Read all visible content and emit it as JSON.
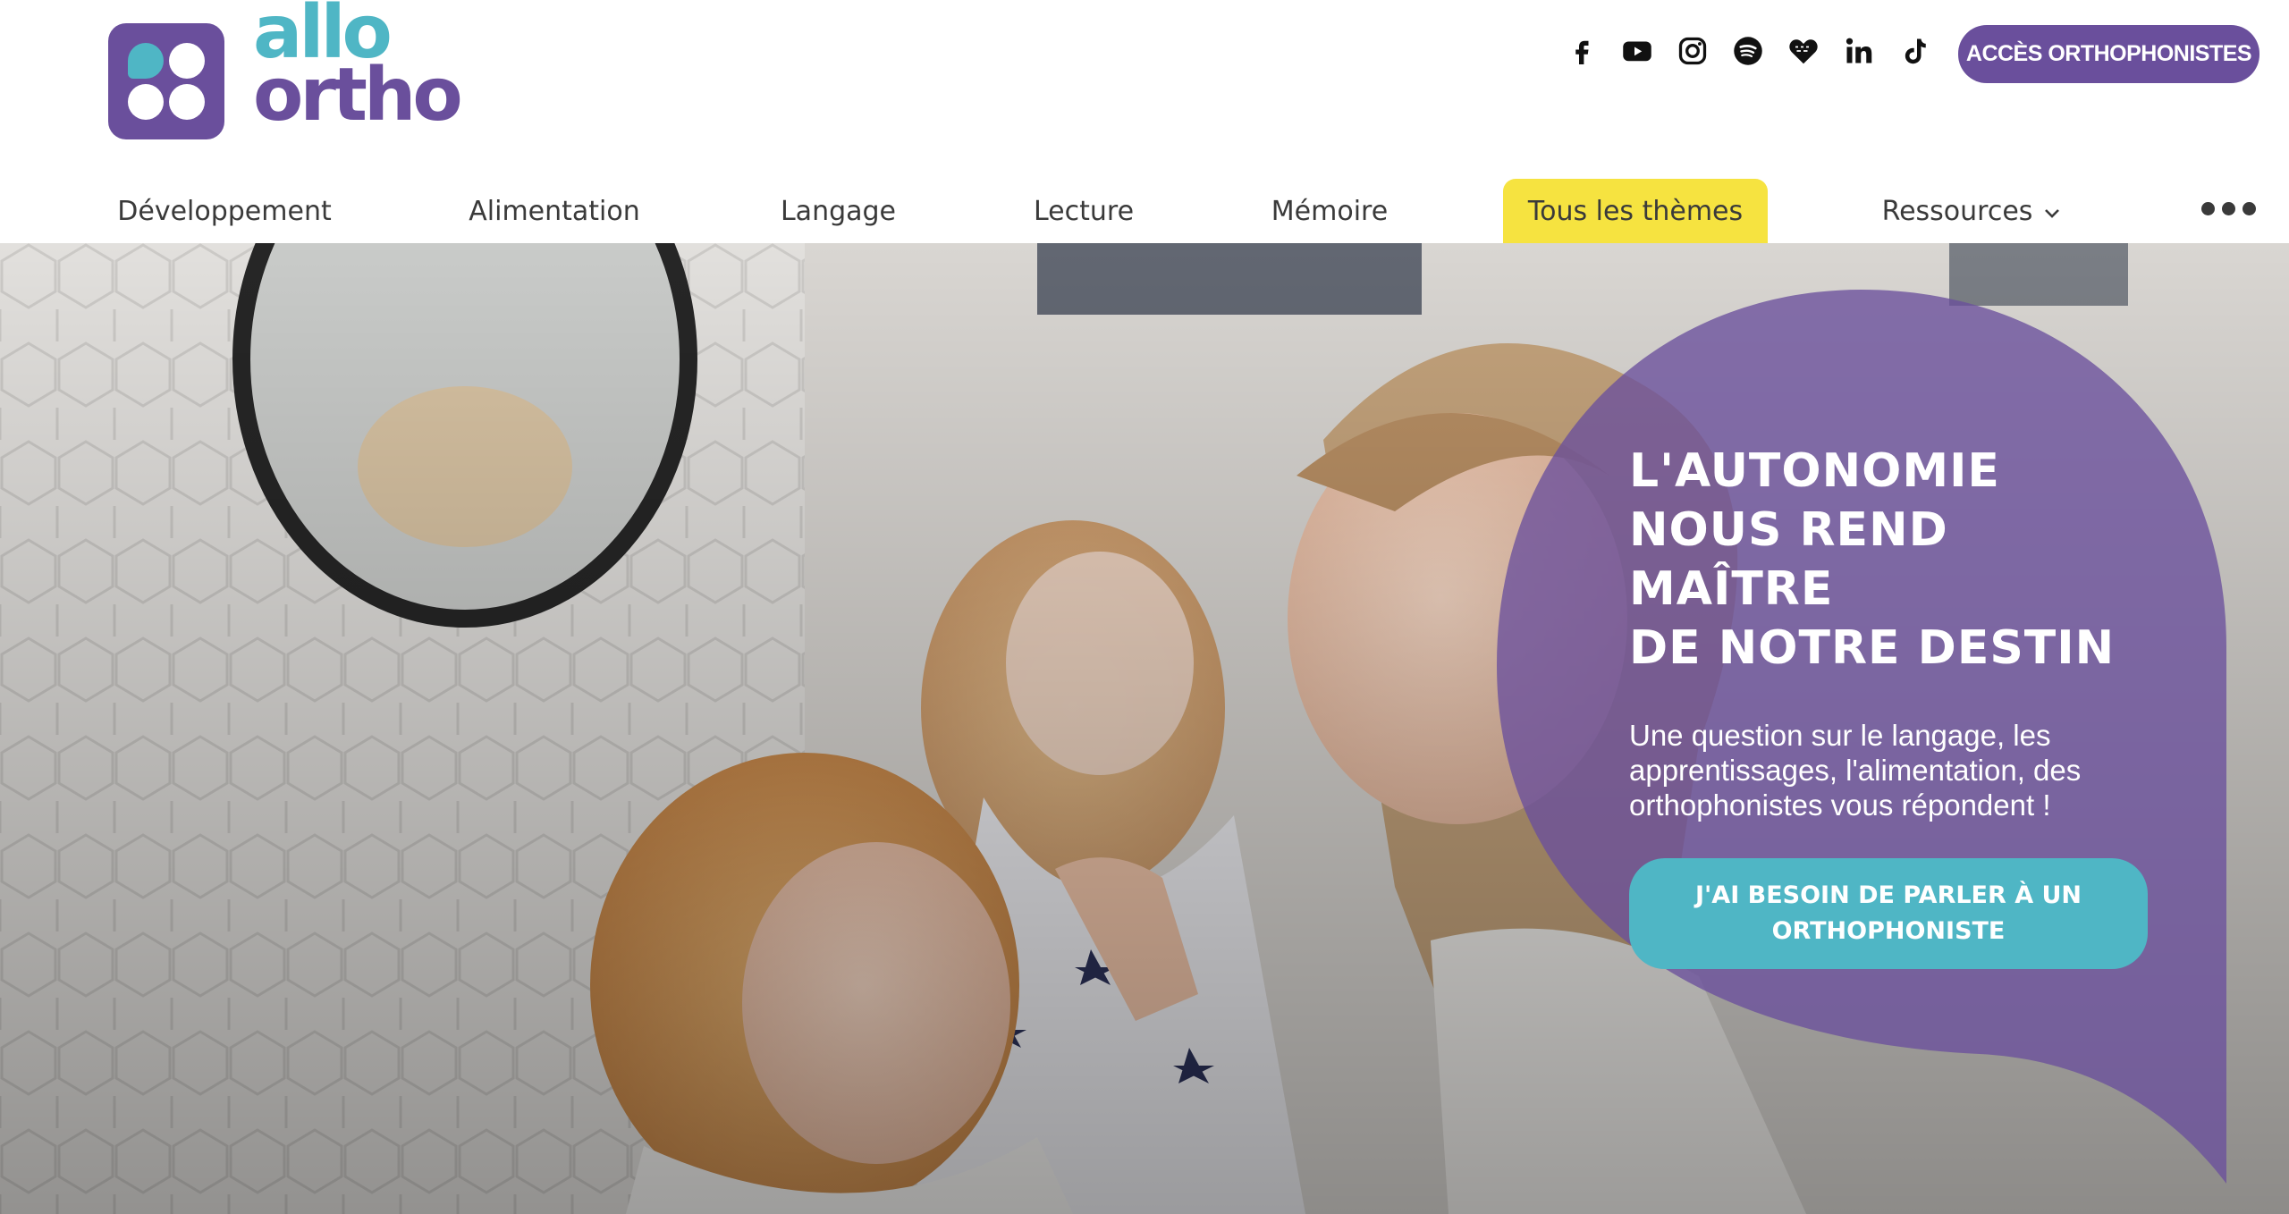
{
  "brand": {
    "line1": "allo",
    "line2": "ortho",
    "colors": {
      "purple": "#6a4f9c",
      "teal": "#4fb6c5",
      "yellow": "#f6e340"
    }
  },
  "social": [
    {
      "name": "facebook-icon"
    },
    {
      "name": "youtube-icon"
    },
    {
      "name": "instagram-icon"
    },
    {
      "name": "spotify-icon"
    },
    {
      "name": "deezer-heart-icon"
    },
    {
      "name": "linkedin-icon"
    },
    {
      "name": "tiktok-icon"
    }
  ],
  "header": {
    "pro_button": "ACCÈS ORTHOPHONISTES"
  },
  "nav": {
    "items": [
      "Développement",
      "Alimentation",
      "Langage",
      "Lecture",
      "Mémoire",
      "Tous les thèmes",
      "Ressources"
    ],
    "active": "Tous les thèmes",
    "more_icon": "ellipsis-icon"
  },
  "hero": {
    "title_lines": [
      "L'AUTONOMIE",
      "NOUS REND MAÎTRE",
      "DE NOTRE DESTIN"
    ],
    "text": "Une question sur le langage, les apprentissages, l'alimentation, des orthophonistes vous répondent !",
    "cta": "J'AI BESOIN DE PARLER À UN ORTHOPHONISTE"
  }
}
